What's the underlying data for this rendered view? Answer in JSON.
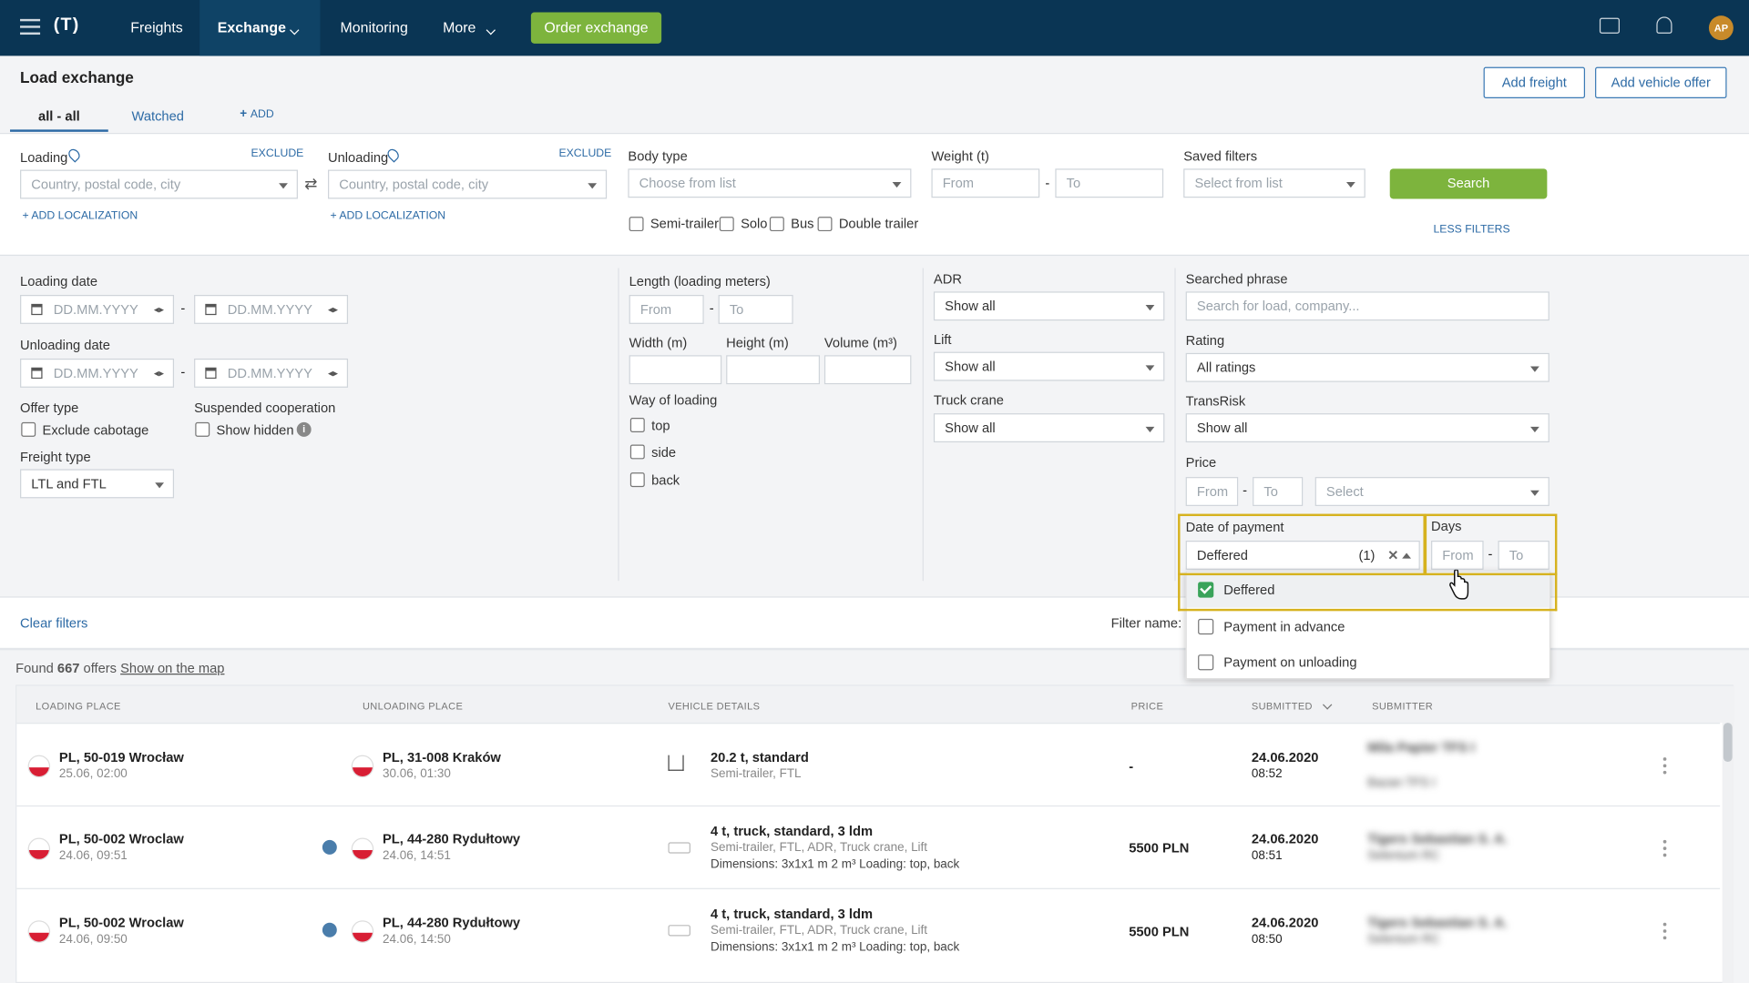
{
  "topbar": {
    "logo": "(T)",
    "nav": [
      "Freights",
      "Exchange",
      "Monitoring",
      "More"
    ],
    "order_btn": "Order exchange",
    "avatar": "AP"
  },
  "page": {
    "title": "Load exchange",
    "tabs": [
      "all - all",
      "Watched"
    ],
    "add": "ADD",
    "add_freight": "Add freight",
    "add_vehicle": "Add vehicle offer"
  },
  "filters": {
    "loading_label": "Loading",
    "unloading_label": "Unloading",
    "exclude": "EXCLUDE",
    "place_placeholder": "Country, postal code, city",
    "add_localization": "ADD LOCALIZATION",
    "body_type_label": "Body type",
    "body_type_placeholder": "Choose from list",
    "body_options": [
      "Semi-trailer",
      "Solo",
      "Bus",
      "Double trailer"
    ],
    "weight_label": "Weight (t)",
    "from": "From",
    "to": "To",
    "saved_label": "Saved filters",
    "saved_placeholder": "Select from list",
    "search_btn": "Search",
    "less_filters": "LESS FILTERS",
    "loading_date": "Loading date",
    "unloading_date": "Unloading date",
    "date_placeholder": "DD.MM.YYYY",
    "offer_type": "Offer type",
    "exclude_cabotage": "Exclude cabotage",
    "suspended": "Suspended cooperation",
    "show_hidden": "Show hidden",
    "freight_type": "Freight type",
    "freight_value": "LTL and FTL",
    "length_label": "Length (loading meters)",
    "width_label": "Width (m)",
    "height_label": "Height (m)",
    "volume_label": "Volume (m³)",
    "way_label": "Way of loading",
    "way_options": [
      "top",
      "side",
      "back"
    ],
    "adr_label": "ADR",
    "lift_label": "Lift",
    "crane_label": "Truck crane",
    "show_all": "Show all",
    "phrase_label": "Searched phrase",
    "phrase_placeholder": "Search for load, company...",
    "rating_label": "Rating",
    "rating_value": "All ratings",
    "transrisk_label": "TransRisk",
    "price_label": "Price",
    "select": "Select",
    "payment_label": "Date of payment",
    "payment_value": "Deffered",
    "payment_count": "(1)",
    "days_label": "Days",
    "payment_options": [
      "Deffered",
      "Payment in advance",
      "Payment on unloading"
    ],
    "clear": "Clear filters",
    "filter_name": "Filter name:"
  },
  "results": {
    "found_prefix": "Found",
    "count": "667",
    "offers": "offers",
    "map_link": "Show on the map"
  },
  "table": {
    "headers": [
      "LOADING PLACE",
      "UNLOADING PLACE",
      "VEHICLE DETAILS",
      "PRICE",
      "SUBMITTED",
      "SUBMITTER"
    ],
    "rows": [
      {
        "load": "PL, 50-019 Wrocław",
        "load_date": "25.06, 02:00",
        "unload": "PL, 31-008 Kraków",
        "unload_date": "30.06, 01:30",
        "veh": "20.2 t, standard",
        "veh2": "Semi-trailer, FTL",
        "veh3": "",
        "price": "-",
        "sub_date": "24.06.2020",
        "sub_time": "08:52",
        "submitter": "Mila Papier TFS I",
        "submitter2": "Bazan TFS I"
      },
      {
        "load": "PL, 50-002 Wroclaw",
        "load_date": "24.06, 09:51",
        "unload": "PL, 44-280 Rydułtowy",
        "unload_date": "24.06, 14:51",
        "veh": "4 t, truck, standard, 3 ldm",
        "veh2": "Semi-trailer, FTL, ADR, Truck crane, Lift",
        "veh3": "Dimensions: 3x1x1 m 2 m³ Loading: top, back",
        "price": "5500 PLN",
        "sub_date": "24.06.2020",
        "sub_time": "08:51",
        "submitter": "Tigers Sebastian S. A.",
        "submitter2": "Selenium RC"
      },
      {
        "load": "PL, 50-002 Wroclaw",
        "load_date": "24.06, 09:50",
        "unload": "PL, 44-280 Rydułtowy",
        "unload_date": "24.06, 14:50",
        "veh": "4 t, truck, standard, 3 ldm",
        "veh2": "Semi-trailer, FTL, ADR, Truck crane, Lift",
        "veh3": "Dimensions: 3x1x1 m 2 m³ Loading: top, back",
        "price": "5500 PLN",
        "sub_date": "24.06.2020",
        "sub_time": "08:50",
        "submitter": "Tigers Sebastian S. A.",
        "submitter2": "Selenium RC"
      }
    ]
  }
}
